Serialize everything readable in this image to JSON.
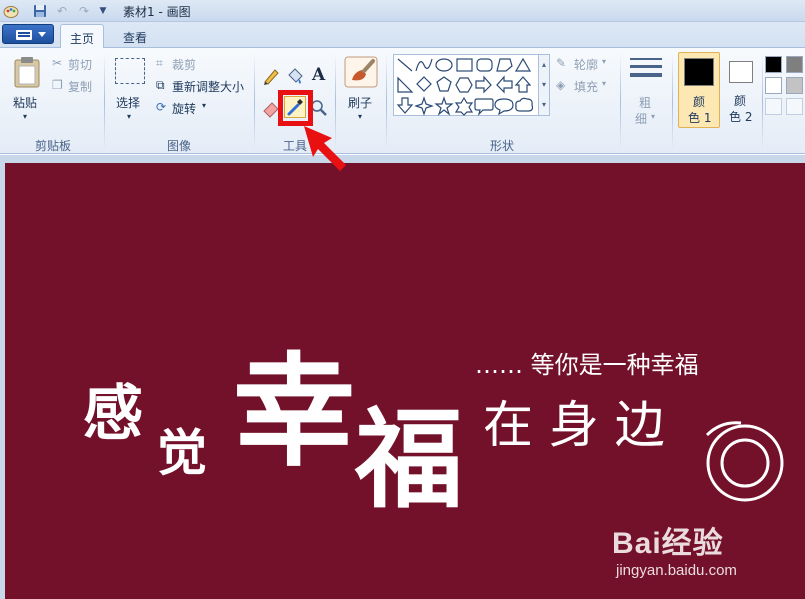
{
  "window": {
    "title": "素材1 - 画图"
  },
  "tabs": [
    {
      "label": "主页"
    },
    {
      "label": "查看"
    }
  ],
  "clipboard": {
    "paste": "粘贴",
    "cut": "剪切",
    "copy": "复制",
    "group": "剪贴板"
  },
  "image": {
    "select": "选择",
    "crop": "裁剪",
    "resize": "重新调整大小",
    "rotate": "旋转",
    "group": "图像"
  },
  "tools": {
    "group": "工具",
    "text_tool": "A"
  },
  "brushes": {
    "label": "刷子"
  },
  "shapes": {
    "outline": "轮廓",
    "fill": "填充",
    "group": "形状"
  },
  "size": {
    "label_line1": "粗",
    "label_line2": "细"
  },
  "colors": {
    "color1_line1": "颜",
    "color1_line2": "色 1",
    "color2_line1": "颜",
    "color2_line2": "色 2",
    "color1_value": "#000000",
    "color2_value": "#ffffff",
    "palette": [
      "#000000",
      "#7f7f7f",
      "#ffffff",
      "#c3c3c3"
    ]
  },
  "canvas": {
    "background": "#74112a",
    "text": {
      "gan": "感",
      "jue": "觉",
      "xing": "幸",
      "fu": "福",
      "zai_shen_bian": "在 身 边",
      "tagline": "…… 等你是一种幸福"
    }
  },
  "watermark": {
    "logo": "Bai经验",
    "site": "jingyan.baidu.com"
  },
  "highlight": {
    "color": "#e81010"
  }
}
